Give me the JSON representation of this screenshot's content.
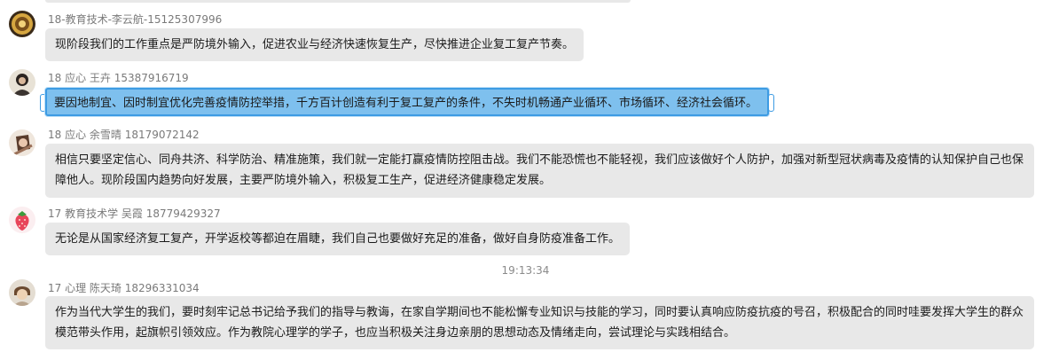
{
  "messages": [
    {
      "sender": "18-教育技术-李云航-15125307996",
      "text": "现阶段我们的工作重点是严防境外输入，促进农业与经济快速恢复生产，尽快推进企业复工复产节奏。",
      "selected": false
    },
    {
      "sender": "18 应心 王卉 15387916719",
      "text": "要因地制宜、因时制宜优化完善疫情防控举措，千方百计创造有利于复工复产的条件，不失时机畅通产业循环、市场循环、经济社会循环。",
      "selected": true
    },
    {
      "sender": "18 应心 余雪晴 18179072142",
      "text": "相信只要坚定信心、同舟共济、科学防治、精准施策，我们就一定能打赢疫情防控阻击战。我们不能恐慌也不能轻视，我们应该做好个人防护，加强对新型冠状病毒及疫情的认知保护自己也保障他人。现阶段国内趋势向好发展，主要严防境外输入，积极复工生产，促进经济健康稳定发展。",
      "selected": false
    },
    {
      "sender": "17 教育技术学 吴霞 18779429327",
      "text": "无论是从国家经济复工复产，开学返校等都迫在眉睫，我们自己也要做好充足的准备，做好自身防疫准备工作。",
      "selected": false
    },
    {
      "sender": "17 心理 陈天琦 18296331034",
      "text": "作为当代大学生的我们，要时刻牢记总书记给予我们的指导与教诲，在家自学期间也不能松懈专业知识与技能的学习，同时要认真响应防疫抗疫的号召，积极配合的同时哇要发挥大学生的群众模范带头作用，起旗帜引领效应。作为教院心理学的学子，也应当积极关注身边亲朋的思想动态及情绪走向，尝试理论与实践相结合。",
      "selected": false
    }
  ],
  "timestamp": "19:13:34",
  "colors": {
    "bubble": "#e8e8e8",
    "selected_bubble": "#7ec0ee",
    "selected_border": "#3d9be3"
  }
}
